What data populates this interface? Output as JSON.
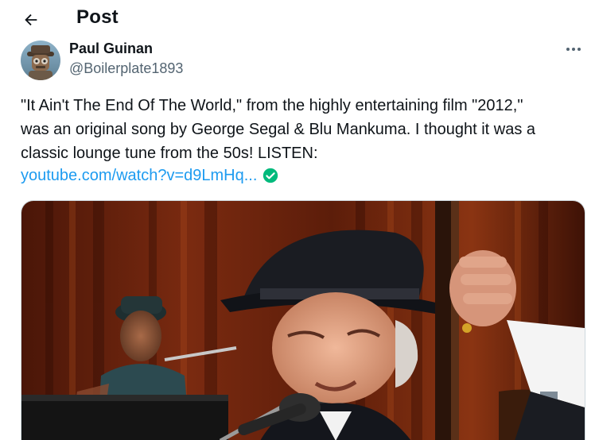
{
  "header": {
    "back_icon": "arrow-left-icon",
    "title": "Post"
  },
  "author": {
    "name": "Paul Guinan",
    "handle": "@Boilerplate1893",
    "avatar_icon": "robot-avatar"
  },
  "tweet": {
    "lines": [
      "\"It Ain't The End Of The World,\" from the highly entertaining film \"2012,\"",
      "was an original song by George Segal & Blu Mankuma. I thought it was a",
      "classic lounge tune from the 50s! LISTEN:"
    ],
    "link_text": "youtube.com/watch?v=d9LmHq...",
    "link_icon": "check-circle-icon"
  },
  "media": {
    "description_icon": "photo"
  },
  "colors": {
    "link": "#1d9bf0",
    "check": "#00ba7c",
    "secondary_text": "#536471"
  }
}
